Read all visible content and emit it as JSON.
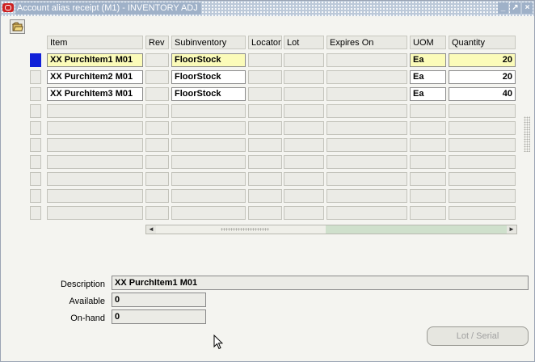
{
  "window": {
    "title": "Account alias receipt (M1) - INVENTORY ADJ",
    "controls": [
      "minimize-icon",
      "maximize-icon",
      "close-icon"
    ]
  },
  "toolbar": {
    "icon": "open-folder-icon"
  },
  "grid": {
    "headers": {
      "item": "Item",
      "rev": "Rev",
      "subinventory": "Subinventory",
      "locator": "Locator",
      "lot": "Lot",
      "expires_on": "Expires On",
      "uom": "UOM",
      "quantity": "Quantity"
    },
    "rows": [
      {
        "item": "XX PurchItem1 M01",
        "rev": "",
        "subinventory": "FloorStock",
        "locator": "",
        "lot": "",
        "expires_on": "",
        "uom": "Ea",
        "quantity": "20"
      },
      {
        "item": "XX PurchItem2 M01",
        "rev": "",
        "subinventory": "FloorStock",
        "locator": "",
        "lot": "",
        "expires_on": "",
        "uom": "Ea",
        "quantity": "20"
      },
      {
        "item": "XX PurchItem3 M01",
        "rev": "",
        "subinventory": "FloorStock",
        "locator": "",
        "lot": "",
        "expires_on": "",
        "uom": "Ea",
        "quantity": "40"
      },
      {
        "item": "",
        "rev": "",
        "subinventory": "",
        "locator": "",
        "lot": "",
        "expires_on": "",
        "uom": "",
        "quantity": ""
      },
      {
        "item": "",
        "rev": "",
        "subinventory": "",
        "locator": "",
        "lot": "",
        "expires_on": "",
        "uom": "",
        "quantity": ""
      },
      {
        "item": "",
        "rev": "",
        "subinventory": "",
        "locator": "",
        "lot": "",
        "expires_on": "",
        "uom": "",
        "quantity": ""
      },
      {
        "item": "",
        "rev": "",
        "subinventory": "",
        "locator": "",
        "lot": "",
        "expires_on": "",
        "uom": "",
        "quantity": ""
      },
      {
        "item": "",
        "rev": "",
        "subinventory": "",
        "locator": "",
        "lot": "",
        "expires_on": "",
        "uom": "",
        "quantity": ""
      },
      {
        "item": "",
        "rev": "",
        "subinventory": "",
        "locator": "",
        "lot": "",
        "expires_on": "",
        "uom": "",
        "quantity": ""
      },
      {
        "item": "",
        "rev": "",
        "subinventory": "",
        "locator": "",
        "lot": "",
        "expires_on": "",
        "uom": "",
        "quantity": ""
      }
    ]
  },
  "details": {
    "description_label": "Description",
    "description_value": "XX PurchItem1 M01",
    "available_label": "Available",
    "available_value": "0",
    "onhand_label": "On-hand",
    "onhand_value": "0"
  },
  "actions": {
    "lot_serial_label": "Lot / Serial"
  },
  "colors": {
    "current_record": "#1020d8",
    "highlight_field": "#fbfbb9",
    "title_bar": "#bcc9d9"
  }
}
